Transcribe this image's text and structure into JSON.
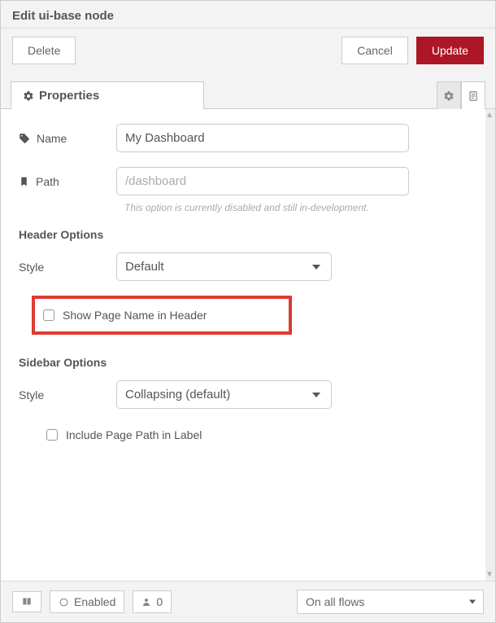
{
  "title": "Edit ui-base node",
  "actions": {
    "delete_label": "Delete",
    "cancel_label": "Cancel",
    "update_label": "Update"
  },
  "tabs": {
    "properties_label": "Properties"
  },
  "form": {
    "name_label": "Name",
    "name_value": "My Dashboard",
    "path_label": "Path",
    "path_placeholder": "/dashboard",
    "path_hint": "This option is currently disabled and still in-development.",
    "header_section": "Header Options",
    "header_style_label": "Style",
    "header_style_value": "Default",
    "show_page_name_label": "Show Page Name in Header",
    "sidebar_section": "Sidebar Options",
    "sidebar_style_label": "Style",
    "sidebar_style_value": "Collapsing (default)",
    "include_path_label": "Include Page Path in Label"
  },
  "footer": {
    "enabled_label": "Enabled",
    "user_count": "0",
    "scope_value": "On all flows"
  }
}
